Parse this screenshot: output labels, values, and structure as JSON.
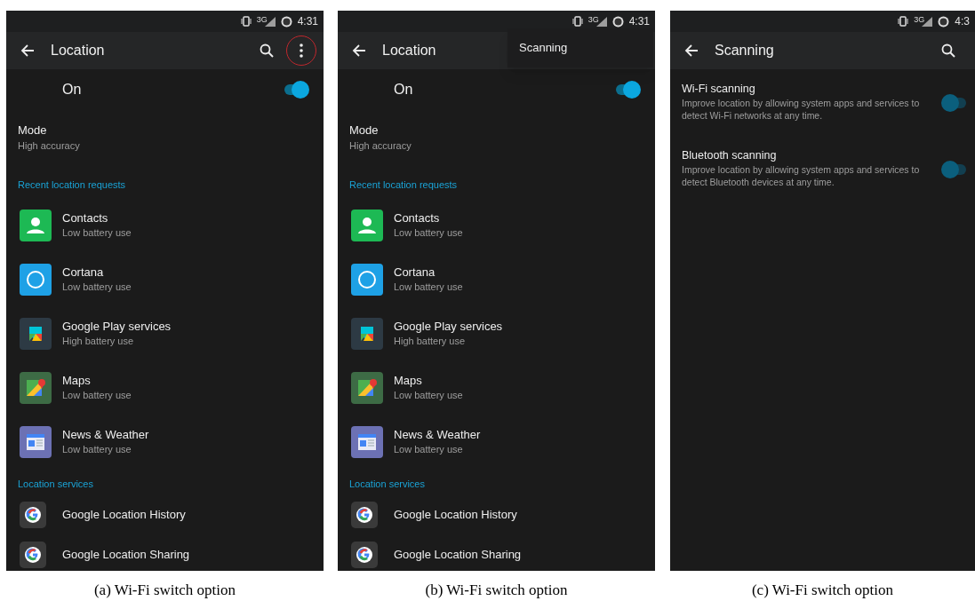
{
  "panels": [
    {
      "kind": "location",
      "caption": "(a) Wi-Fi switch option",
      "network_type": "3G",
      "status_time": "4:31",
      "title": "Location",
      "menu_highlighted": true,
      "master_switch": {
        "label": "On",
        "on": true
      },
      "mode": {
        "title": "Mode",
        "value": "High accuracy"
      },
      "sections": [
        {
          "header": "Recent location requests",
          "items": [
            {
              "kind": "person",
              "name": "Contacts",
              "subtitle": "Low battery use"
            },
            {
              "kind": "circle",
              "name": "Cortana",
              "subtitle": "Low battery use"
            },
            {
              "kind": "puzzle",
              "name": "Google Play services",
              "subtitle": "High battery use"
            },
            {
              "kind": "map",
              "name": "Maps",
              "subtitle": "Low battery use"
            },
            {
              "kind": "newspaper",
              "name": "News & Weather",
              "subtitle": "Low battery use"
            }
          ]
        },
        {
          "header": "Location services",
          "items": [
            {
              "kind": "g-logo",
              "name": "Google Location History"
            },
            {
              "kind": "g-logo",
              "name": "Google Location Sharing"
            }
          ]
        }
      ]
    },
    {
      "kind": "location",
      "caption": "(b) Wi-Fi switch option",
      "network_type": "3G",
      "status_time": "4:31",
      "title": "Location",
      "overflow_menu": [
        "Scanning"
      ],
      "master_switch": {
        "label": "On",
        "on": true
      },
      "mode": {
        "title": "Mode",
        "value": "High accuracy"
      },
      "sections": [
        {
          "header": "Recent location requests",
          "items": [
            {
              "kind": "person",
              "name": "Contacts",
              "subtitle": "Low battery use"
            },
            {
              "kind": "circle",
              "name": "Cortana",
              "subtitle": "Low battery use"
            },
            {
              "kind": "puzzle",
              "name": "Google Play services",
              "subtitle": "High battery use"
            },
            {
              "kind": "map",
              "name": "Maps",
              "subtitle": "Low battery use"
            },
            {
              "kind": "newspaper",
              "name": "News & Weather",
              "subtitle": "Low battery use"
            }
          ]
        },
        {
          "header": "Location services",
          "items": [
            {
              "kind": "g-logo",
              "name": "Google Location History"
            },
            {
              "kind": "g-logo",
              "name": "Google Location Sharing"
            }
          ]
        }
      ]
    },
    {
      "kind": "scanning",
      "caption": "(c) Wi-Fi switch option",
      "network_type": "3G",
      "status_time": "4:3",
      "title": "Scanning",
      "settings": [
        {
          "title": "Wi-Fi scanning",
          "description": "Improve location by allowing system apps and services to detect Wi-Fi networks at any time.",
          "on": false
        },
        {
          "title": "Bluetooth scanning",
          "description": "Improve location by allowing system apps and services to detect Bluetooth devices at any time.",
          "on": false
        }
      ]
    }
  ]
}
